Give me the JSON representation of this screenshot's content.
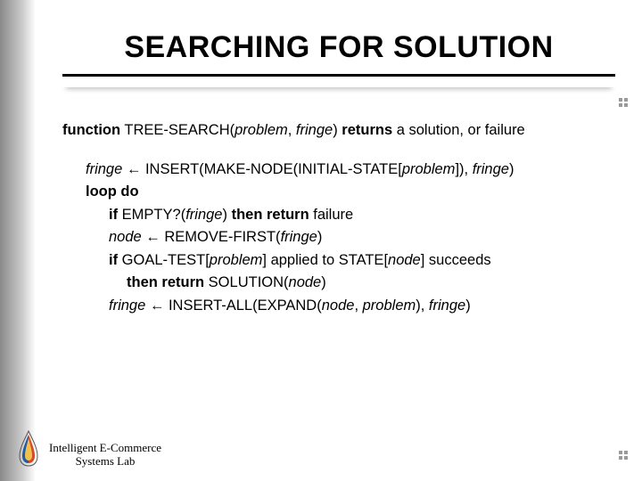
{
  "title": "SEARCHING FOR SOLUTION",
  "algo": {
    "sig": {
      "kw_function": "function",
      "name": " TREE-SEARCH(",
      "arg1": "problem",
      "comma": ", ",
      "arg2": "fringe",
      "close": ") ",
      "kw_returns": "returns",
      "tail": " a solution, or failure"
    },
    "l1": {
      "lhs": "fringe",
      "arrow": " ← ",
      "rhs1": "INSERT(MAKE-NODE(INITIAL-STATE[",
      "prob": "problem",
      "rhs2": "]), ",
      "fr": "fringe",
      "rhs3": ")"
    },
    "loop": "loop do",
    "l2": {
      "kw_if": "if",
      "mid1": " EMPTY?(",
      "fr": "fringe",
      "mid2": ") ",
      "kw_then": "then return",
      "tail": " failure"
    },
    "l3": {
      "lhs": "node",
      "arrow": " ← ",
      "rhs1": "REMOVE-FIRST(",
      "fr": "fringe",
      "rhs2": ")"
    },
    "l4": {
      "kw_if": "if",
      "mid1": " GOAL-TEST[",
      "prob": "problem",
      "mid2": "] applied to STATE[",
      "node": "node",
      "mid3": "] succeeds"
    },
    "l5": {
      "kw_then": "then return",
      "mid": " SOLUTION(",
      "node": "node",
      "tail": ")"
    },
    "l6": {
      "lhs": "fringe",
      "arrow": " ← ",
      "rhs1": "INSERT-ALL(EXPAND(",
      "node": "node",
      "comma1": ", ",
      "prob": "problem",
      "comma2": "), ",
      "fr": "fringe",
      "rhs2": ")"
    }
  },
  "footer": {
    "line1": "Intelligent E-Commerce",
    "line2": "Systems Lab"
  }
}
